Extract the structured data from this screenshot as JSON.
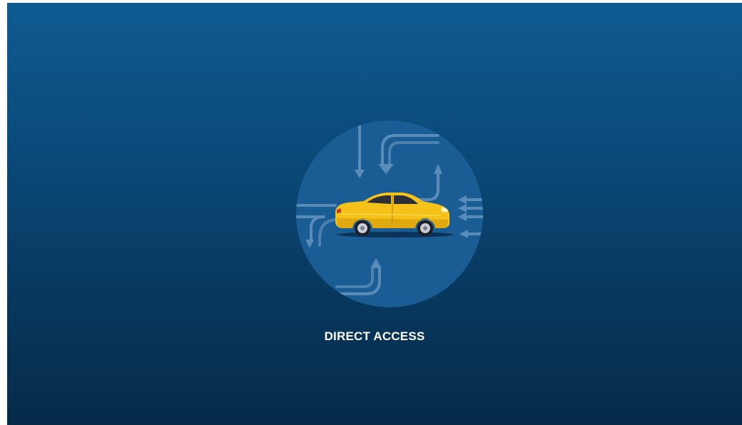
{
  "screen": {
    "title": "DIRECT ACCESS",
    "icon": "car-direct-access-icon",
    "colors": {
      "background_top": "#0e5b92",
      "background_bottom": "#062a48",
      "circle": "#1a5d94",
      "car_body": "#f5c21a",
      "arrows": "#6f9cc4",
      "label": "#ffffff"
    }
  }
}
